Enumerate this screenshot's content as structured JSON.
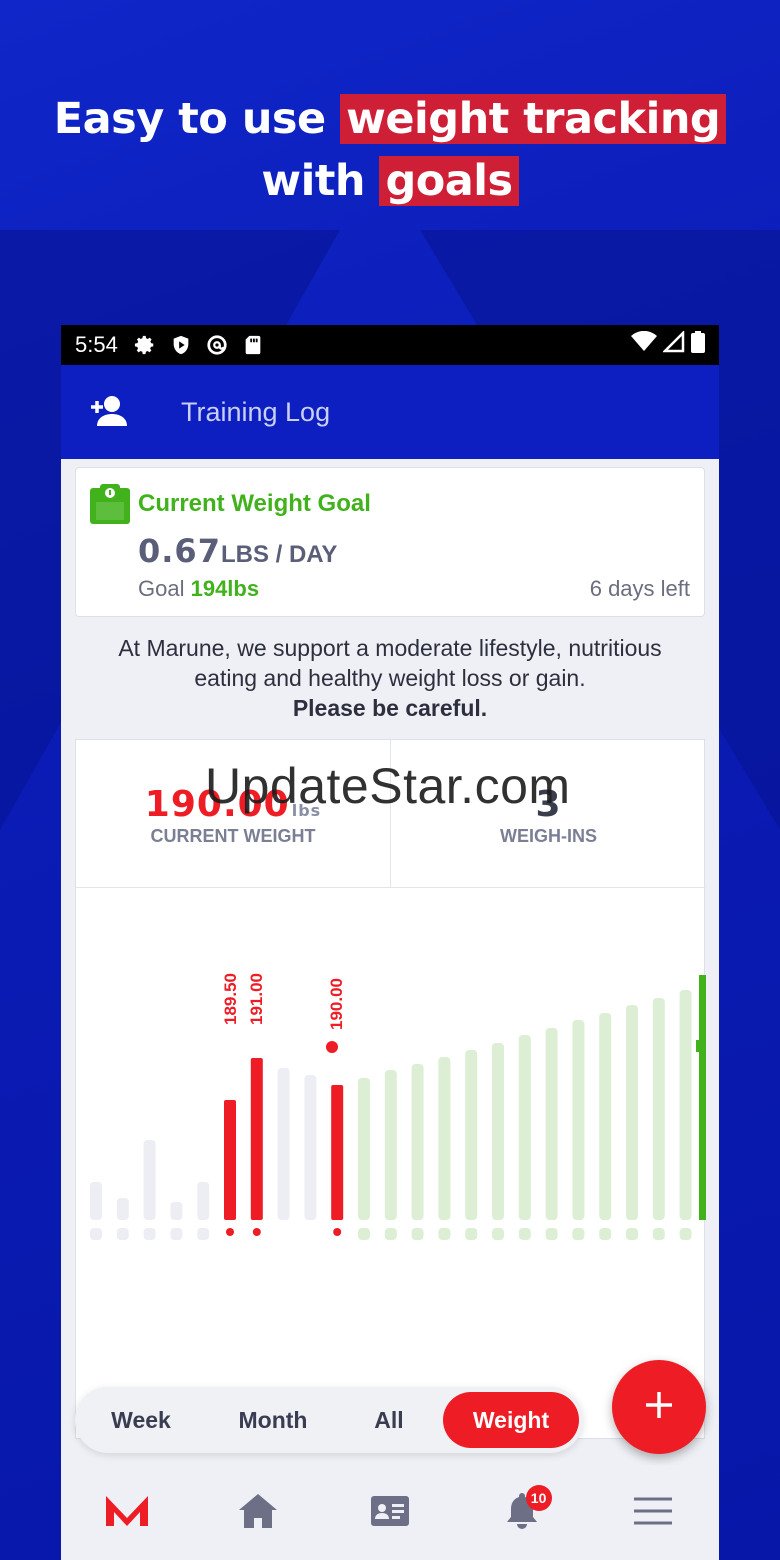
{
  "headline": {
    "part1": "Easy to use ",
    "highlight1": "weight tracking",
    "part2": "with ",
    "highlight2": "goals"
  },
  "status_bar": {
    "time": "5:54",
    "icons": [
      "gear-icon",
      "shield-play-icon",
      "at-sign-icon",
      "sd-card-icon",
      "wifi-icon",
      "signal-icon",
      "battery-icon"
    ]
  },
  "app_bar": {
    "title": "Training Log",
    "left_icon": "add-user-icon"
  },
  "goal_card": {
    "title": "Current Weight Goal",
    "icon": "scale-icon",
    "rate_value": "0.67",
    "rate_unit": "LBS / DAY",
    "goal_prefix": "Goal ",
    "goal_value": "194lbs",
    "days_left": "6 days left"
  },
  "support_text": {
    "line": "At Marune, we support a moderate lifestyle, nutritious eating and healthy weight loss or gain.",
    "emphasis": "Please be careful."
  },
  "stats": {
    "current_weight": "190.00",
    "current_weight_unit": "lbs",
    "current_weight_label": "CURRENT WEIGHT",
    "weigh_ins": "3",
    "weigh_ins_label": "WEIGH-INS"
  },
  "watermark": "UpdateStar.com",
  "chart_data": {
    "type": "bar",
    "series": [
      {
        "name": "past",
        "values": [
          38,
          22,
          80,
          18,
          38
        ],
        "color": "#eceef3"
      },
      {
        "name": "logged",
        "values": [
          120,
          162,
          null,
          null,
          135
        ],
        "color": "#ee1c24"
      },
      {
        "name": "inactive",
        "values": [
          null,
          null,
          152,
          145,
          null
        ],
        "color": "#eceef3"
      },
      {
        "name": "projection",
        "values": [
          142,
          150,
          156,
          163,
          170,
          177,
          185,
          192,
          200,
          207,
          215,
          222,
          230,
          237
        ],
        "color": "#dcefd4"
      }
    ],
    "labels": [
      "189.50",
      "191.00",
      "190.00"
    ],
    "colors": {
      "logged": "#ee1c24",
      "projection": "#dcefd4",
      "goal": "#41b21c",
      "empty": "#eceef3"
    }
  },
  "range_buttons": [
    "Week",
    "Month",
    "All",
    "Weight"
  ],
  "active_range": "Weight",
  "fab_icon": "plus-icon",
  "bottom_nav": {
    "items": [
      "logo-icon",
      "home-icon",
      "id-card-icon",
      "bell-icon",
      "menu-icon"
    ],
    "badge": "10"
  }
}
